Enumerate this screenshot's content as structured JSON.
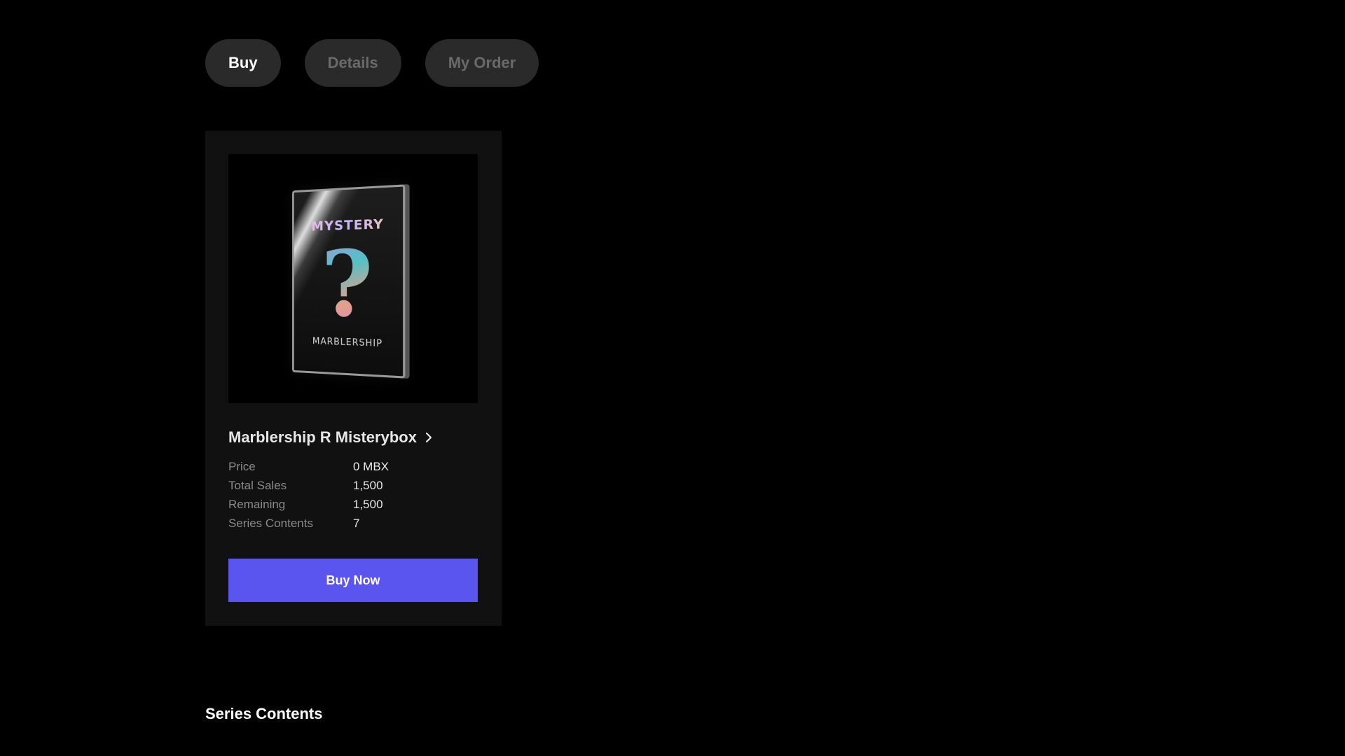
{
  "tabs": [
    {
      "label": "Buy",
      "active": true
    },
    {
      "label": "Details",
      "active": false
    },
    {
      "label": "My Order",
      "active": false
    }
  ],
  "product": {
    "image_text": {
      "top": "MYSTERY",
      "glyph": "?",
      "bottom": "MARBLERSHIP"
    },
    "title": "Marblership R Misterybox",
    "stats": [
      {
        "label": "Price",
        "value": "0 MBX"
      },
      {
        "label": "Total Sales",
        "value": "1,500"
      },
      {
        "label": "Remaining",
        "value": "1,500"
      },
      {
        "label": "Series Contents",
        "value": "7"
      }
    ],
    "buy_label": "Buy Now"
  },
  "section": {
    "title": "Series Contents"
  },
  "colors": {
    "background": "#000000",
    "card": "#111111",
    "tab": "#2a2a2a",
    "accent": "#5a55ee"
  },
  "icons": {
    "title_link": "chevron-right-icon"
  }
}
